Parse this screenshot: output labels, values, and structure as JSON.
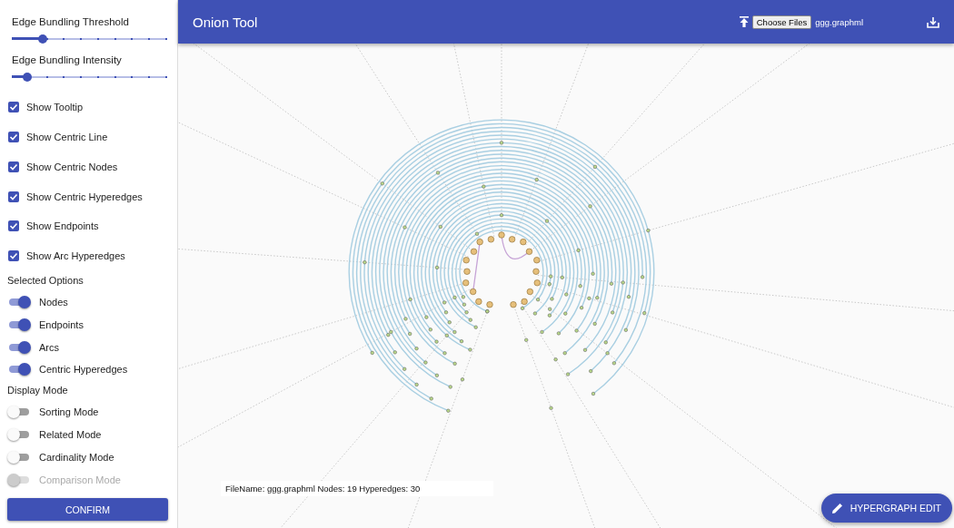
{
  "sidebar": {
    "sliders": [
      {
        "label": "Edge Bundling Threshold",
        "level": 0.2
      },
      {
        "label": "Edge Bundling Intensity",
        "level": 0.1
      }
    ],
    "checkboxes": [
      {
        "label": "Show Tooltip",
        "checked": true
      },
      {
        "label": "Show Centric Line",
        "checked": true
      },
      {
        "label": "Show Centric Nodes",
        "checked": true
      },
      {
        "label": "Show Centric Hyperedges",
        "checked": true
      },
      {
        "label": "Show Endpoints",
        "checked": true
      },
      {
        "label": "Show Arc Hyperedges",
        "checked": true
      }
    ],
    "selected_options": {
      "title": "Selected Options",
      "toggles": [
        {
          "label": "Nodes",
          "on": true,
          "disabled": false
        },
        {
          "label": "Endpoints",
          "on": true,
          "disabled": false
        },
        {
          "label": "Arcs",
          "on": true,
          "disabled": false
        },
        {
          "label": "Centric Hyperedges",
          "on": true,
          "disabled": false
        }
      ]
    },
    "display_mode": {
      "title": "Display Mode",
      "toggles": [
        {
          "label": "Sorting Mode",
          "on": false,
          "disabled": false
        },
        {
          "label": "Related Mode",
          "on": false,
          "disabled": false
        },
        {
          "label": "Cardinality Mode",
          "on": false,
          "disabled": false
        },
        {
          "label": "Comparison Mode",
          "on": false,
          "disabled": true
        }
      ]
    },
    "confirm_button": "CONFIRM"
  },
  "app_bar": {
    "title": "Onion Tool",
    "choose_files_button": "Choose Files",
    "file_name": "ggg.graphml"
  },
  "info_box": "FileName: ggg.graphml Nodes: 19 Hyperedges: 30",
  "edit_button": "HYPERGRAPH EDIT"
}
